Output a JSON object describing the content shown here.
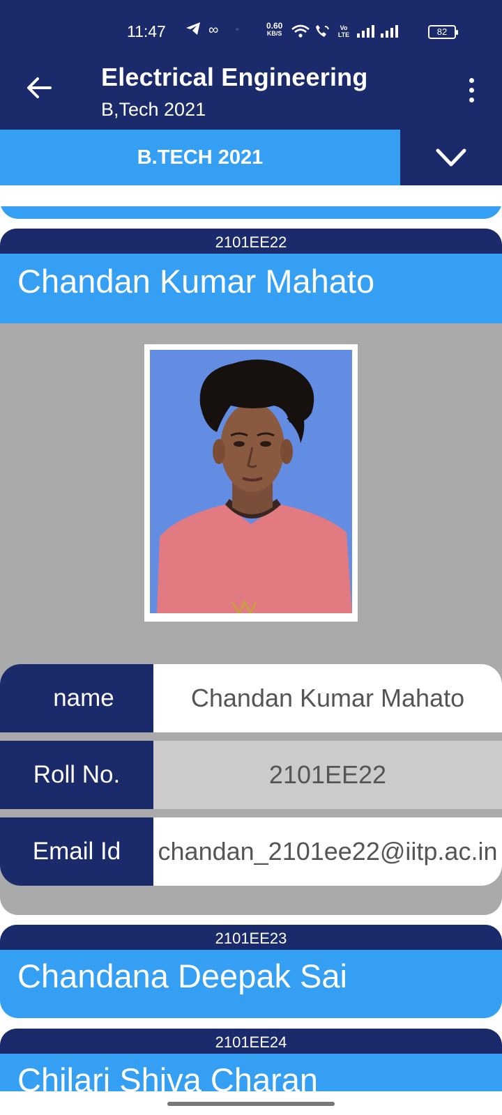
{
  "status_bar": {
    "time": "11:47",
    "net_speed_value": "0.60",
    "net_speed_unit": "KB/S",
    "volte": "Vo LTE",
    "battery": "82"
  },
  "app_bar": {
    "title": "Electrical Engineering",
    "subtitle": "B,Tech 2021",
    "back_icon": "arrow-left-icon",
    "menu_icon": "more-vert-icon"
  },
  "batch_selector": {
    "label": "B.TECH 2021",
    "dropdown_icon": "chevron-down-icon"
  },
  "students": [
    {
      "roll_no": "2101EE22",
      "name": "Chandan Kumar Mahato",
      "expanded": true,
      "details": {
        "name_key": "name",
        "name_value": "Chandan Kumar Mahato",
        "roll_key": "Roll No.",
        "roll_value": "2101EE22",
        "email_key": "Email Id",
        "email_value": "chandan_2101ee22@iitp.ac.in"
      }
    },
    {
      "roll_no": "2101EE23",
      "name": "Chandana Deepak Sai",
      "expanded": false
    },
    {
      "roll_no": "2101EE24",
      "name": "Chilari Shiva Charan",
      "expanded": false
    }
  ],
  "colors": {
    "navy": "#1b2a6b",
    "accent_blue": "#35a0f3",
    "card_body_gray": "#aaaaaa",
    "row_alt_gray": "#cccaca"
  }
}
